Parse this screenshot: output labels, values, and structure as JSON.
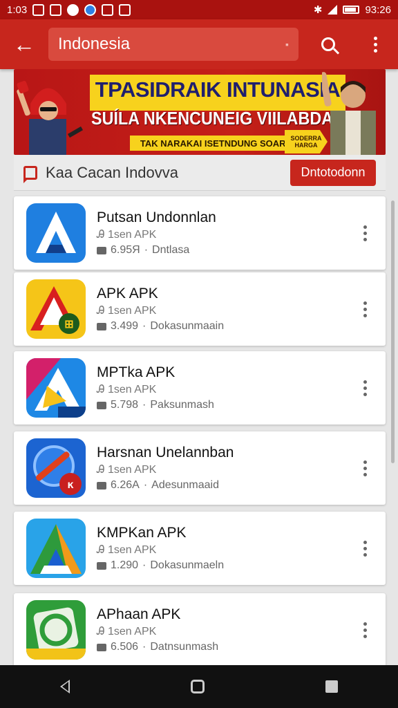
{
  "status": {
    "time": "1:03",
    "clock": "93:26"
  },
  "search": {
    "query": "Indonesia"
  },
  "banner": {
    "title": "TPASIDRAIK INTUNASIA",
    "subtitle": "SUÍLA NKENCUNEIG VIILABDAS",
    "tagline": "TAK NARAKAI ISETNDUNG SOARCO",
    "badge": "SODERRA HARGA"
  },
  "section": {
    "label": "Kaa Cacan Indovva",
    "button": "Dntotodonn"
  },
  "apps": [
    {
      "name": "Putsan Undonnlan",
      "sub": "Ꭿ 1sen APK",
      "size": "6.95Я",
      "meta": "Dntlasa"
    },
    {
      "name": "APK APK",
      "sub": "Ꭿ 1sen APK",
      "size": "3.499",
      "meta": "Dokasunmaain"
    },
    {
      "name": "MPTka APK",
      "sub": "Ꭿ 1sen APK",
      "size": "5.798",
      "meta": "Paksunmash"
    },
    {
      "name": "Harsnan Unelannban",
      "sub": "Ꭿ 1sen APK",
      "size": "6.26Α",
      "meta": "Adesunmaaid"
    },
    {
      "name": "KMPKan APK",
      "sub": "Ꭿ 1sen APK",
      "size": "1.290",
      "meta": "Dokasunmaeln"
    },
    {
      "name": "APhaan APK",
      "sub": "Ꭿ 1sen APK",
      "size": "6.506",
      "meta": "Datnsunmash"
    }
  ],
  "colors": {
    "appbar": "#c7261d",
    "statusbar": "#a9120f",
    "accent": "#c7261d"
  },
  "icons": [
    "back-arrow-icon",
    "search-icon",
    "more-vert-icon",
    "chat-icon",
    "nav-back-icon",
    "nav-home-icon",
    "nav-recent-icon"
  ]
}
